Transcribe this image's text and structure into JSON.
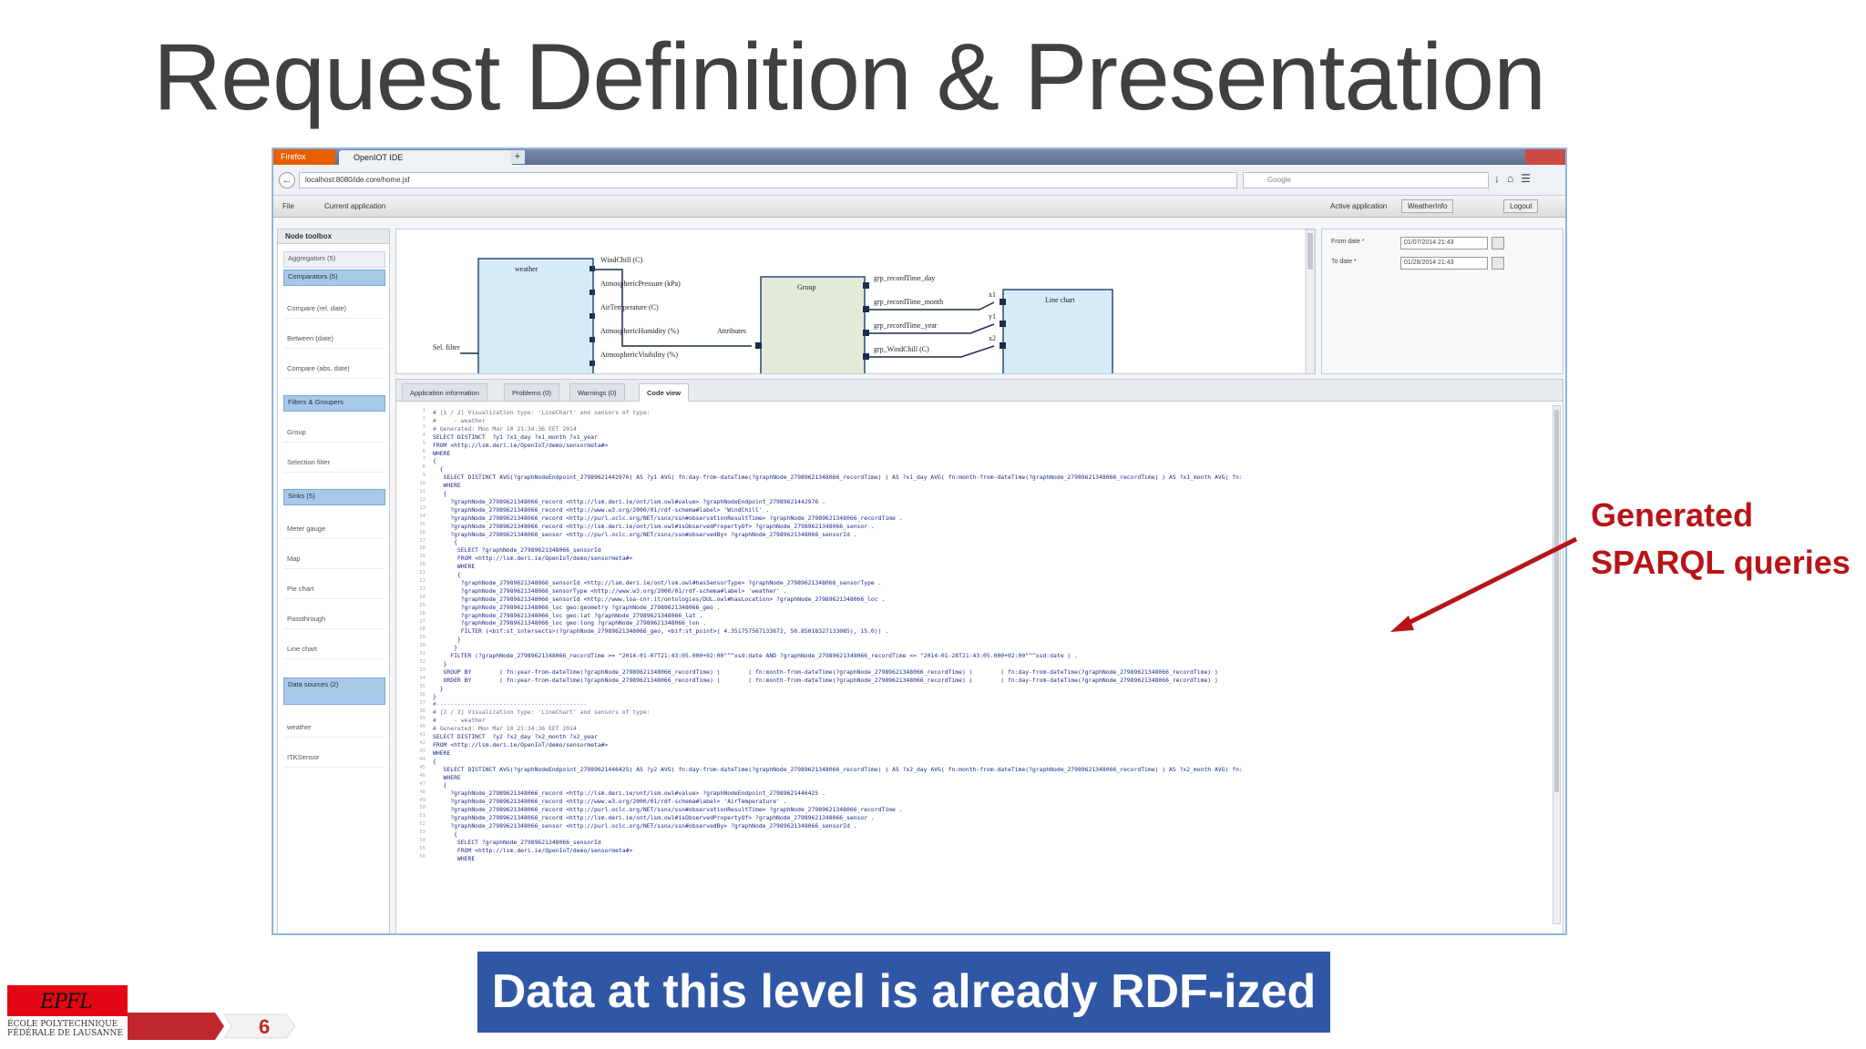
{
  "slide": {
    "title": "Request Definition & Presentation",
    "callout_line1": "Generated",
    "callout_line2": "SPARQL queries",
    "banner": "Data at this level is already RDF-ized",
    "page_number": "6",
    "logo_text": "EPFL",
    "logo_sub1": "ÉCOLE POLYTECHNIQUE",
    "logo_sub2": "FÉDÉRALE DE LAUSANNE",
    "accent_color": "#b81418",
    "banner_color": "#2f57a5"
  },
  "browser": {
    "firefox_label": "Firefox",
    "tab_title": "OpenIOT IDE",
    "url": "localhost:8080/ide.core/home.jsf",
    "search_placeholder": "Google"
  },
  "app": {
    "menu_file": "File",
    "menu_current_app": "Current application",
    "active_app_label": "Active application",
    "active_app_value": "WeatherInfo",
    "logout": "Logout"
  },
  "left_panel": {
    "header": "Node toolbox",
    "items": [
      {
        "label": "Aggregators (5)"
      },
      {
        "label": "Comparators (5)"
      },
      {
        "label": "Compare (rel. date)"
      },
      {
        "label": "Between (date)"
      },
      {
        "label": "Compare (abs. date)"
      },
      {
        "label": "Filters & Groupers"
      },
      {
        "label": "Group"
      },
      {
        "label": "Selection filter"
      },
      {
        "label": "Sinks (5)"
      },
      {
        "label": "Meter gauge"
      },
      {
        "label": "Map"
      },
      {
        "label": "Pie chart"
      },
      {
        "label": "Passthrough"
      },
      {
        "label": "Line chart"
      },
      {
        "label": "Data sources (2)"
      },
      {
        "label": "weather"
      },
      {
        "label": "ITKSensor"
      }
    ]
  },
  "canvas": {
    "weather_node": "weather",
    "weather_ports": [
      "WindChill (C)",
      "AtmosphericPressure (kPa)",
      "AirTemperature (C)",
      "AtmosphericHumidity (%)",
      "AtmosphericVisibility (%)"
    ],
    "sel_filter": "Sel. filter",
    "attributes": "Attributes",
    "group_node": "Group",
    "group_ports": [
      "grp_recordTime_day",
      "grp_recordTime_month",
      "grp_recordTime_year",
      "grp_WindChill (C)"
    ],
    "line_chart_node": "Line chart",
    "line_ports": [
      "x1",
      "y1",
      "x2"
    ]
  },
  "date_panel": {
    "from_label": "From date *",
    "from_value": "01/07/2014 21:43",
    "to_label": "To date *",
    "to_value": "01/28/2014 21:43"
  },
  "code_tabs": [
    "Application information",
    "Problems (0)",
    "Warnings (0)",
    "Code view"
  ],
  "code": [
    {
      "t": "# [1 / 2] Visualization type: 'LineChart' and sensors of type:",
      "c": true
    },
    {
      "t": "#     - weather",
      "c": true
    },
    {
      "t": "# Generated: Mon Mar 10 21:34:36 EET 2014",
      "c": true
    },
    {
      "t": "SELECT DISTINCT  ?y1 ?x1_day ?x1_month ?x1_year",
      "c": false
    },
    {
      "t": "FROM <http://lsm.deri.ie/OpenIoT/demo/sensormeta#>",
      "c": false
    },
    {
      "t": "WHERE",
      "c": false
    },
    {
      "t": "{",
      "c": false
    },
    {
      "t": "  {",
      "c": false
    },
    {
      "t": "   SELECT DISTINCT AVG(?graphNodeEndpoint_27989621442976) AS ?y1 AVG( fn:day-from-dateTime(?graphNode_27989621348066_recordTime) ) AS ?x1_day AVG( fn:month-from-dateTime(?graphNode_27989621348066_recordTime) ) AS ?x1_month AVG( fn:",
      "c": false
    },
    {
      "t": "   WHERE",
      "c": false
    },
    {
      "t": "   {",
      "c": false
    },
    {
      "t": "     ?graphNode_27989621348066_record <http://lsm.deri.ie/ont/lsm.owl#value> ?graphNodeEndpoint_27989621442976 .",
      "c": false
    },
    {
      "t": "     ?graphNode_27989621348066_record <http://www.w3.org/2000/01/rdf-schema#label> 'WindChill' .",
      "c": false
    },
    {
      "t": "     ?graphNode_27989621348066_record <http://purl.oclc.org/NET/ssnx/ssn#observationResultTime> ?graphNode_27989621348066_recordTime .",
      "c": false
    },
    {
      "t": "     ?graphNode_27989621348066_record <http://lsm.deri.ie/ont/lsm.owl#isObservedPropertyOf> ?graphNode_27989621348066_sensor .",
      "c": false
    },
    {
      "t": "     ?graphNode_27989621348066_sensor <http://purl.oclc.org/NET/ssnx/ssn#observedBy> ?graphNode_27989621348066_sensorId .",
      "c": false
    },
    {
      "t": "      {",
      "c": false
    },
    {
      "t": "       SELECT ?graphNode_27989621348066_sensorId",
      "c": false
    },
    {
      "t": "       FROM <http://lsm.deri.ie/OpenIoT/demo/sensormeta#>",
      "c": false
    },
    {
      "t": "       WHERE",
      "c": false
    },
    {
      "t": "       {",
      "c": false
    },
    {
      "t": "        ?graphNode_27989621348066_sensorId <http://lsm.deri.ie/ont/lsm.owl#hasSensorType> ?graphNode_27989621348066_sensorType .",
      "c": false
    },
    {
      "t": "        ?graphNode_27989621348066_sensorType <http://www.w3.org/2000/01/rdf-schema#label> 'weather' .",
      "c": false
    },
    {
      "t": "        ?graphNode_27989621348066_sensorId <http://www.loa-cnr.it/ontologies/DUL.owl#hasLocation> ?graphNode_27989621348066_loc .",
      "c": false
    },
    {
      "t": "        ?graphNode_27989621348066_loc geo:geometry ?graphNode_27989621348066_geo .",
      "c": false
    },
    {
      "t": "        ?graphNode_27989621348066_loc geo:lat ?graphNode_27989621348066_lat .",
      "c": false
    },
    {
      "t": "        ?graphNode_27989621348066_loc geo:long ?graphNode_27989621348066_lon .",
      "c": false
    },
    {
      "t": "        FILTER (<bif:st_intersects>(?graphNode_27989621348066_geo, <bif:st_point>( 4.351757567133672, 50.85018327133085), 15.0)) .",
      "c": false
    },
    {
      "t": "       }",
      "c": false
    },
    {
      "t": "      }",
      "c": false
    },
    {
      "t": "     FILTER (?graphNode_27989621348066_recordTime >= \"2014-01-07T21:43:05.000+02:00\"^^xsd:date AND ?graphNode_27989621348066_recordTime <= \"2014-01-28T21:43:05.000+02:00\"^^xsd:date ) .",
      "c": false
    },
    {
      "t": "   }",
      "c": false
    },
    {
      "t": "   GROUP BY        ( fn:year-from-dateTime(?graphNode_27989621348066_recordTime) )        ( fn:month-from-dateTime(?graphNode_27989621348066_recordTime) )        ( fn:day-from-dateTime(?graphNode_27989621348066_recordTime) )",
      "c": false
    },
    {
      "t": "   ORDER BY        ( fn:year-from-dateTime(?graphNode_27989621348066_recordTime) )        ( fn:month-from-dateTime(?graphNode_27989621348066_recordTime) )        ( fn:day-from-dateTime(?graphNode_27989621348066_recordTime) )",
      "c": false
    },
    {
      "t": "  }",
      "c": false
    },
    {
      "t": "}",
      "c": false
    },
    {
      "t": "#-------------------------------------------",
      "c": true
    },
    {
      "t": "# [2 / 2] Visualization type: 'LineChart' and sensors of type:",
      "c": true
    },
    {
      "t": "#     - weather",
      "c": true
    },
    {
      "t": "# Generated: Mon Mar 10 21:34:36 EET 2014",
      "c": true
    },
    {
      "t": "SELECT DISTINCT  ?y2 ?x2_day ?x2_month ?x2_year",
      "c": false
    },
    {
      "t": "FROM <http://lsm.deri.ie/OpenIoT/demo/sensormeta#>",
      "c": false
    },
    {
      "t": "WHERE",
      "c": false
    },
    {
      "t": "{",
      "c": false
    },
    {
      "t": "   SELECT DISTINCT AVG(?graphNodeEndpoint_27989621446425) AS ?y2 AVG( fn:day-from-dateTime(?graphNode_27989621348066_recordTime) ) AS ?x2_day AVG( fn:month-from-dateTime(?graphNode_27989621348066_recordTime) ) AS ?x2_month AVG( fn:",
      "c": false
    },
    {
      "t": "   WHERE",
      "c": false
    },
    {
      "t": "   {",
      "c": false
    },
    {
      "t": "     ?graphNode_27989621348066_record <http://lsm.deri.ie/ont/lsm.owl#value> ?graphNodeEndpoint_27989621446425 .",
      "c": false
    },
    {
      "t": "     ?graphNode_27989621348066_record <http://www.w3.org/2000/01/rdf-schema#label> 'AirTemperature' .",
      "c": false
    },
    {
      "t": "     ?graphNode_27989621348066_record <http://purl.oclc.org/NET/ssnx/ssn#observationResultTime> ?graphNode_27989621348066_recordTime .",
      "c": false
    },
    {
      "t": "     ?graphNode_27989621348066_record <http://lsm.deri.ie/ont/lsm.owl#isObservedPropertyOf> ?graphNode_27989621348066_sensor .",
      "c": false
    },
    {
      "t": "     ?graphNode_27989621348066_sensor <http://purl.oclc.org/NET/ssnx/ssn#observedBy> ?graphNode_27989621348066_sensorId .",
      "c": false
    },
    {
      "t": "      {",
      "c": false
    },
    {
      "t": "       SELECT ?graphNode_27989621348066_sensorId",
      "c": false
    },
    {
      "t": "       FROM <http://lsm.deri.ie/OpenIoT/demo/sensormeta#>",
      "c": false
    },
    {
      "t": "       WHERE",
      "c": false
    }
  ]
}
